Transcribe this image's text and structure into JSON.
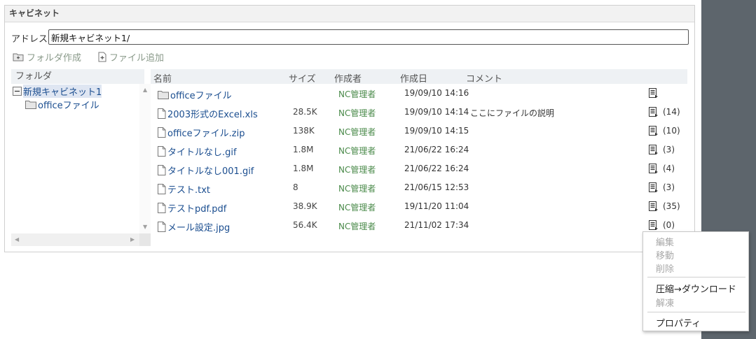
{
  "panel": {
    "title": "キャビネット"
  },
  "address": {
    "label": "アドレス",
    "value": "新規キャビネット1/"
  },
  "toolbar": {
    "create_folder": "フォルダ作成",
    "add_file": "ファイル追加"
  },
  "tree": {
    "header": "フォルダ",
    "root": {
      "label": "新規キャビネット1",
      "icon": "collapse-icon"
    },
    "children": [
      {
        "label": "officeファイル",
        "icon": "folder-icon"
      }
    ]
  },
  "files": {
    "columns": {
      "name": "名前",
      "size": "サイズ",
      "owner": "作成者",
      "created": "作成日",
      "comment": "コメント"
    },
    "rows": [
      {
        "type": "folder",
        "name": "officeファイル",
        "size": "",
        "owner": "NC管理者",
        "created": "19/09/10 14:16",
        "comment": "",
        "count": ""
      },
      {
        "type": "file",
        "name": "2003形式のExcel.xls",
        "size": "28.5K",
        "owner": "NC管理者",
        "created": "19/09/10 14:14",
        "comment": "ここにファイルの説明",
        "count": "(14)"
      },
      {
        "type": "file",
        "name": "officeファイル.zip",
        "size": "138K",
        "owner": "NC管理者",
        "created": "19/09/10 14:15",
        "comment": "",
        "count": "(10)"
      },
      {
        "type": "file",
        "name": "タイトルなし.gif",
        "size": "1.8M",
        "owner": "NC管理者",
        "created": "21/06/22 16:24",
        "comment": "",
        "count": "(3)"
      },
      {
        "type": "file",
        "name": "タイトルなし001.gif",
        "size": "1.8M",
        "owner": "NC管理者",
        "created": "21/06/22 16:24",
        "comment": "",
        "count": "(4)"
      },
      {
        "type": "file",
        "name": "テスト.txt",
        "size": "8",
        "owner": "NC管理者",
        "created": "21/06/15 12:53",
        "comment": "",
        "count": "(3)"
      },
      {
        "type": "file",
        "name": "テストpdf.pdf",
        "size": "38.9K",
        "owner": "NC管理者",
        "created": "19/11/20 11:04",
        "comment": "",
        "count": "(35)"
      },
      {
        "type": "file",
        "name": "メール設定.jpg",
        "size": "56.4K",
        "owner": "NC管理者",
        "created": "21/11/02 17:34",
        "comment": "",
        "count": "(0)"
      }
    ]
  },
  "context_menu": {
    "edit": "編集",
    "move": "移動",
    "delete": "削除",
    "compress_download": "圧縮→ダウンロード",
    "extract": "解凍",
    "properties": "プロパティ"
  },
  "colors": {
    "link": "#1a4d8f",
    "owner": "#4a8a4a",
    "sidebar": "#5d656c",
    "header_bg": "#eef1f4",
    "disabled": "#a8a8a8"
  }
}
